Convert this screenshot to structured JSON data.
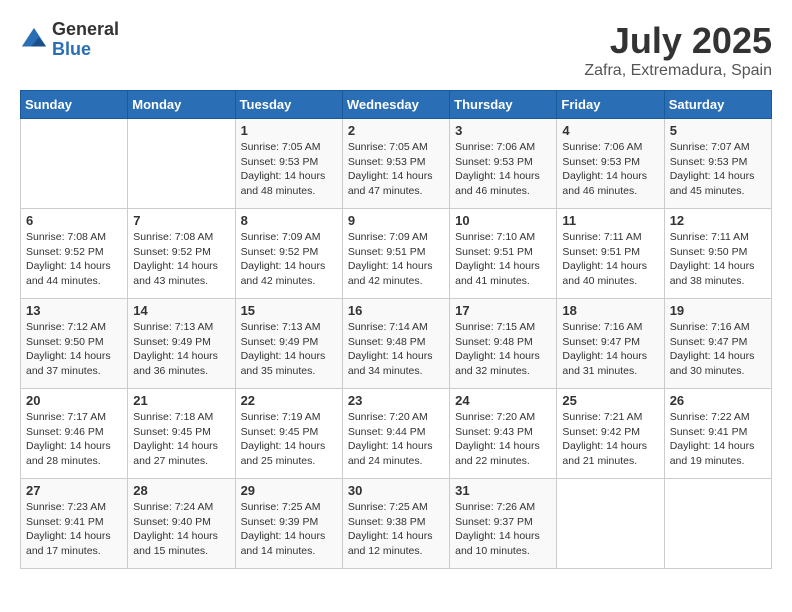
{
  "header": {
    "logo_general": "General",
    "logo_blue": "Blue",
    "month_year": "July 2025",
    "location": "Zafra, Extremadura, Spain"
  },
  "days_of_week": [
    "Sunday",
    "Monday",
    "Tuesday",
    "Wednesday",
    "Thursday",
    "Friday",
    "Saturday"
  ],
  "weeks": [
    [
      {
        "day": "",
        "info": ""
      },
      {
        "day": "",
        "info": ""
      },
      {
        "day": "1",
        "info": "Sunrise: 7:05 AM\nSunset: 9:53 PM\nDaylight: 14 hours\nand 48 minutes."
      },
      {
        "day": "2",
        "info": "Sunrise: 7:05 AM\nSunset: 9:53 PM\nDaylight: 14 hours\nand 47 minutes."
      },
      {
        "day": "3",
        "info": "Sunrise: 7:06 AM\nSunset: 9:53 PM\nDaylight: 14 hours\nand 46 minutes."
      },
      {
        "day": "4",
        "info": "Sunrise: 7:06 AM\nSunset: 9:53 PM\nDaylight: 14 hours\nand 46 minutes."
      },
      {
        "day": "5",
        "info": "Sunrise: 7:07 AM\nSunset: 9:53 PM\nDaylight: 14 hours\nand 45 minutes."
      }
    ],
    [
      {
        "day": "6",
        "info": "Sunrise: 7:08 AM\nSunset: 9:52 PM\nDaylight: 14 hours\nand 44 minutes."
      },
      {
        "day": "7",
        "info": "Sunrise: 7:08 AM\nSunset: 9:52 PM\nDaylight: 14 hours\nand 43 minutes."
      },
      {
        "day": "8",
        "info": "Sunrise: 7:09 AM\nSunset: 9:52 PM\nDaylight: 14 hours\nand 42 minutes."
      },
      {
        "day": "9",
        "info": "Sunrise: 7:09 AM\nSunset: 9:51 PM\nDaylight: 14 hours\nand 42 minutes."
      },
      {
        "day": "10",
        "info": "Sunrise: 7:10 AM\nSunset: 9:51 PM\nDaylight: 14 hours\nand 41 minutes."
      },
      {
        "day": "11",
        "info": "Sunrise: 7:11 AM\nSunset: 9:51 PM\nDaylight: 14 hours\nand 40 minutes."
      },
      {
        "day": "12",
        "info": "Sunrise: 7:11 AM\nSunset: 9:50 PM\nDaylight: 14 hours\nand 38 minutes."
      }
    ],
    [
      {
        "day": "13",
        "info": "Sunrise: 7:12 AM\nSunset: 9:50 PM\nDaylight: 14 hours\nand 37 minutes."
      },
      {
        "day": "14",
        "info": "Sunrise: 7:13 AM\nSunset: 9:49 PM\nDaylight: 14 hours\nand 36 minutes."
      },
      {
        "day": "15",
        "info": "Sunrise: 7:13 AM\nSunset: 9:49 PM\nDaylight: 14 hours\nand 35 minutes."
      },
      {
        "day": "16",
        "info": "Sunrise: 7:14 AM\nSunset: 9:48 PM\nDaylight: 14 hours\nand 34 minutes."
      },
      {
        "day": "17",
        "info": "Sunrise: 7:15 AM\nSunset: 9:48 PM\nDaylight: 14 hours\nand 32 minutes."
      },
      {
        "day": "18",
        "info": "Sunrise: 7:16 AM\nSunset: 9:47 PM\nDaylight: 14 hours\nand 31 minutes."
      },
      {
        "day": "19",
        "info": "Sunrise: 7:16 AM\nSunset: 9:47 PM\nDaylight: 14 hours\nand 30 minutes."
      }
    ],
    [
      {
        "day": "20",
        "info": "Sunrise: 7:17 AM\nSunset: 9:46 PM\nDaylight: 14 hours\nand 28 minutes."
      },
      {
        "day": "21",
        "info": "Sunrise: 7:18 AM\nSunset: 9:45 PM\nDaylight: 14 hours\nand 27 minutes."
      },
      {
        "day": "22",
        "info": "Sunrise: 7:19 AM\nSunset: 9:45 PM\nDaylight: 14 hours\nand 25 minutes."
      },
      {
        "day": "23",
        "info": "Sunrise: 7:20 AM\nSunset: 9:44 PM\nDaylight: 14 hours\nand 24 minutes."
      },
      {
        "day": "24",
        "info": "Sunrise: 7:20 AM\nSunset: 9:43 PM\nDaylight: 14 hours\nand 22 minutes."
      },
      {
        "day": "25",
        "info": "Sunrise: 7:21 AM\nSunset: 9:42 PM\nDaylight: 14 hours\nand 21 minutes."
      },
      {
        "day": "26",
        "info": "Sunrise: 7:22 AM\nSunset: 9:41 PM\nDaylight: 14 hours\nand 19 minutes."
      }
    ],
    [
      {
        "day": "27",
        "info": "Sunrise: 7:23 AM\nSunset: 9:41 PM\nDaylight: 14 hours\nand 17 minutes."
      },
      {
        "day": "28",
        "info": "Sunrise: 7:24 AM\nSunset: 9:40 PM\nDaylight: 14 hours\nand 15 minutes."
      },
      {
        "day": "29",
        "info": "Sunrise: 7:25 AM\nSunset: 9:39 PM\nDaylight: 14 hours\nand 14 minutes."
      },
      {
        "day": "30",
        "info": "Sunrise: 7:25 AM\nSunset: 9:38 PM\nDaylight: 14 hours\nand 12 minutes."
      },
      {
        "day": "31",
        "info": "Sunrise: 7:26 AM\nSunset: 9:37 PM\nDaylight: 14 hours\nand 10 minutes."
      },
      {
        "day": "",
        "info": ""
      },
      {
        "day": "",
        "info": ""
      }
    ]
  ]
}
